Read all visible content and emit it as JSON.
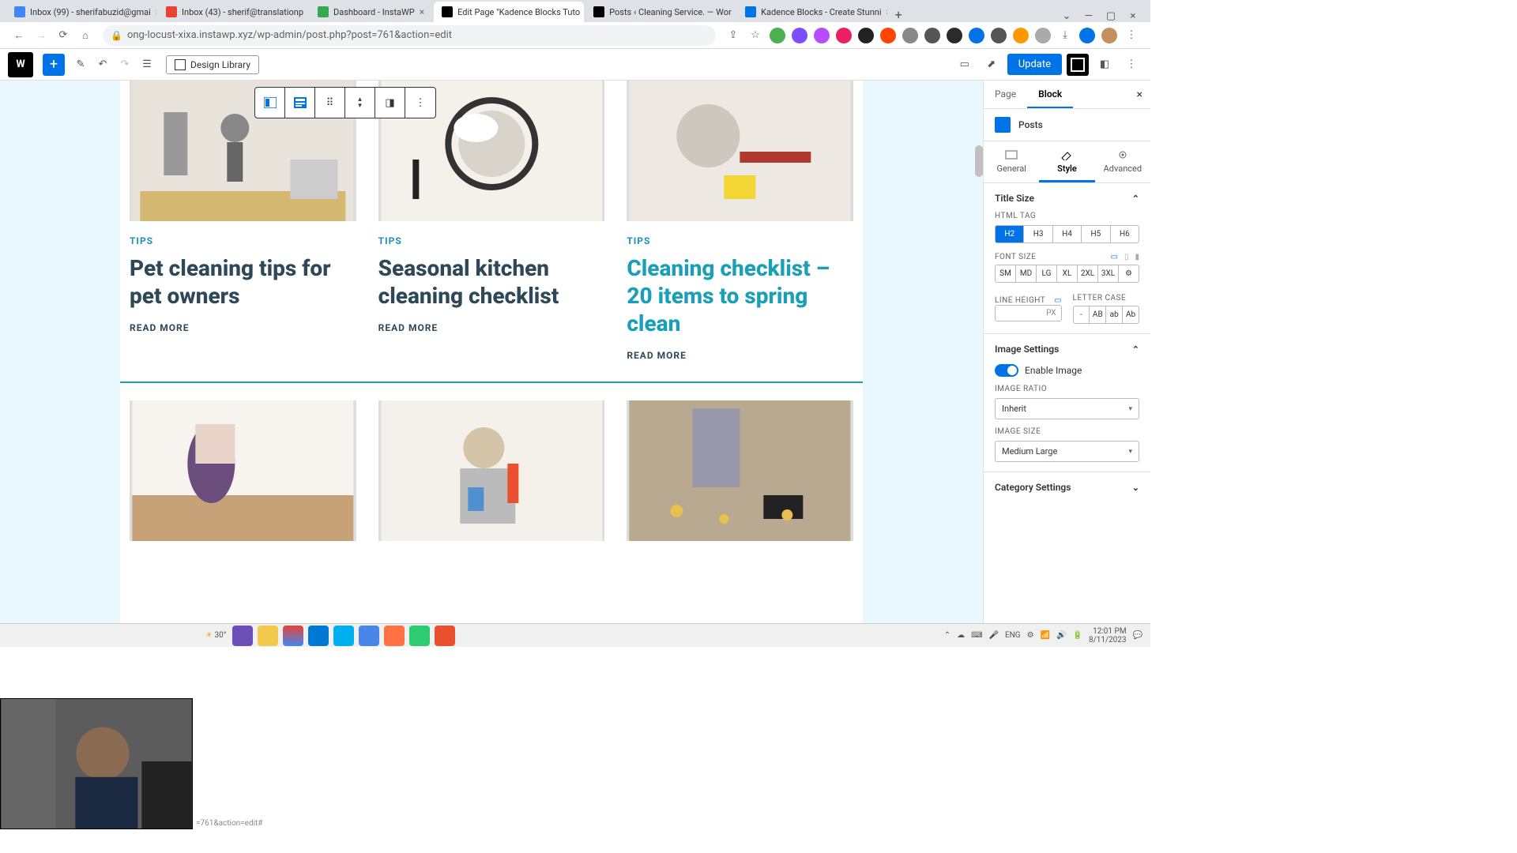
{
  "browser": {
    "tabs": [
      {
        "label": "Inbox (99) - sherifabuzid@gmai"
      },
      {
        "label": "Inbox (43) - sherif@translationp"
      },
      {
        "label": "Dashboard - InstaWP"
      },
      {
        "label": "Edit Page \"Kadence Blocks Tuto"
      },
      {
        "label": "Posts ‹ Cleaning Service. — Wor"
      },
      {
        "label": "Kadence Blocks - Create Stunni"
      }
    ],
    "url": "ong-locust-xixa.instawp.xyz/wp-admin/post.php?post=761&action=edit"
  },
  "wp": {
    "design_library": "Design Library",
    "update": "Update"
  },
  "posts": [
    {
      "category": "TIPS",
      "title": "Pet cleaning tips for pet owners",
      "cta": "READ MORE"
    },
    {
      "category": "TIPS",
      "title": "Seasonal kitchen cleaning checklist",
      "cta": "READ MORE"
    },
    {
      "category": "TIPS",
      "title": "Cleaning checklist – 20 items to spring clean",
      "cta": "READ MORE"
    }
  ],
  "sidebar": {
    "tabs": {
      "page": "Page",
      "block": "Block"
    },
    "block_name": "Posts",
    "subtabs": {
      "general": "General",
      "style": "Style",
      "advanced": "Advanced"
    },
    "title_size": {
      "head": "Title Size",
      "html_tag_label": "HTML TAG",
      "html_tags": [
        "H2",
        "H3",
        "H4",
        "H5",
        "H6"
      ],
      "font_size_label": "FONT SIZE",
      "font_sizes": [
        "SM",
        "MD",
        "LG",
        "XL",
        "2XL",
        "3XL"
      ],
      "line_height_label": "LINE HEIGHT",
      "line_height_unit": "PX",
      "letter_case_label": "LETTER CASE",
      "letter_cases": [
        "-",
        "AB",
        "ab",
        "Ab"
      ]
    },
    "image": {
      "head": "Image Settings",
      "enable": "Enable Image",
      "ratio_label": "IMAGE RATIO",
      "ratio_value": "Inherit",
      "size_label": "IMAGE SIZE",
      "size_value": "Medium Large"
    },
    "category": {
      "head": "Category Settings"
    }
  },
  "taskbar": {
    "temp": "30°",
    "lang": "ENG",
    "time": "12:01 PM",
    "date": "8/11/2023"
  },
  "status_url": "=761&action=edit#"
}
